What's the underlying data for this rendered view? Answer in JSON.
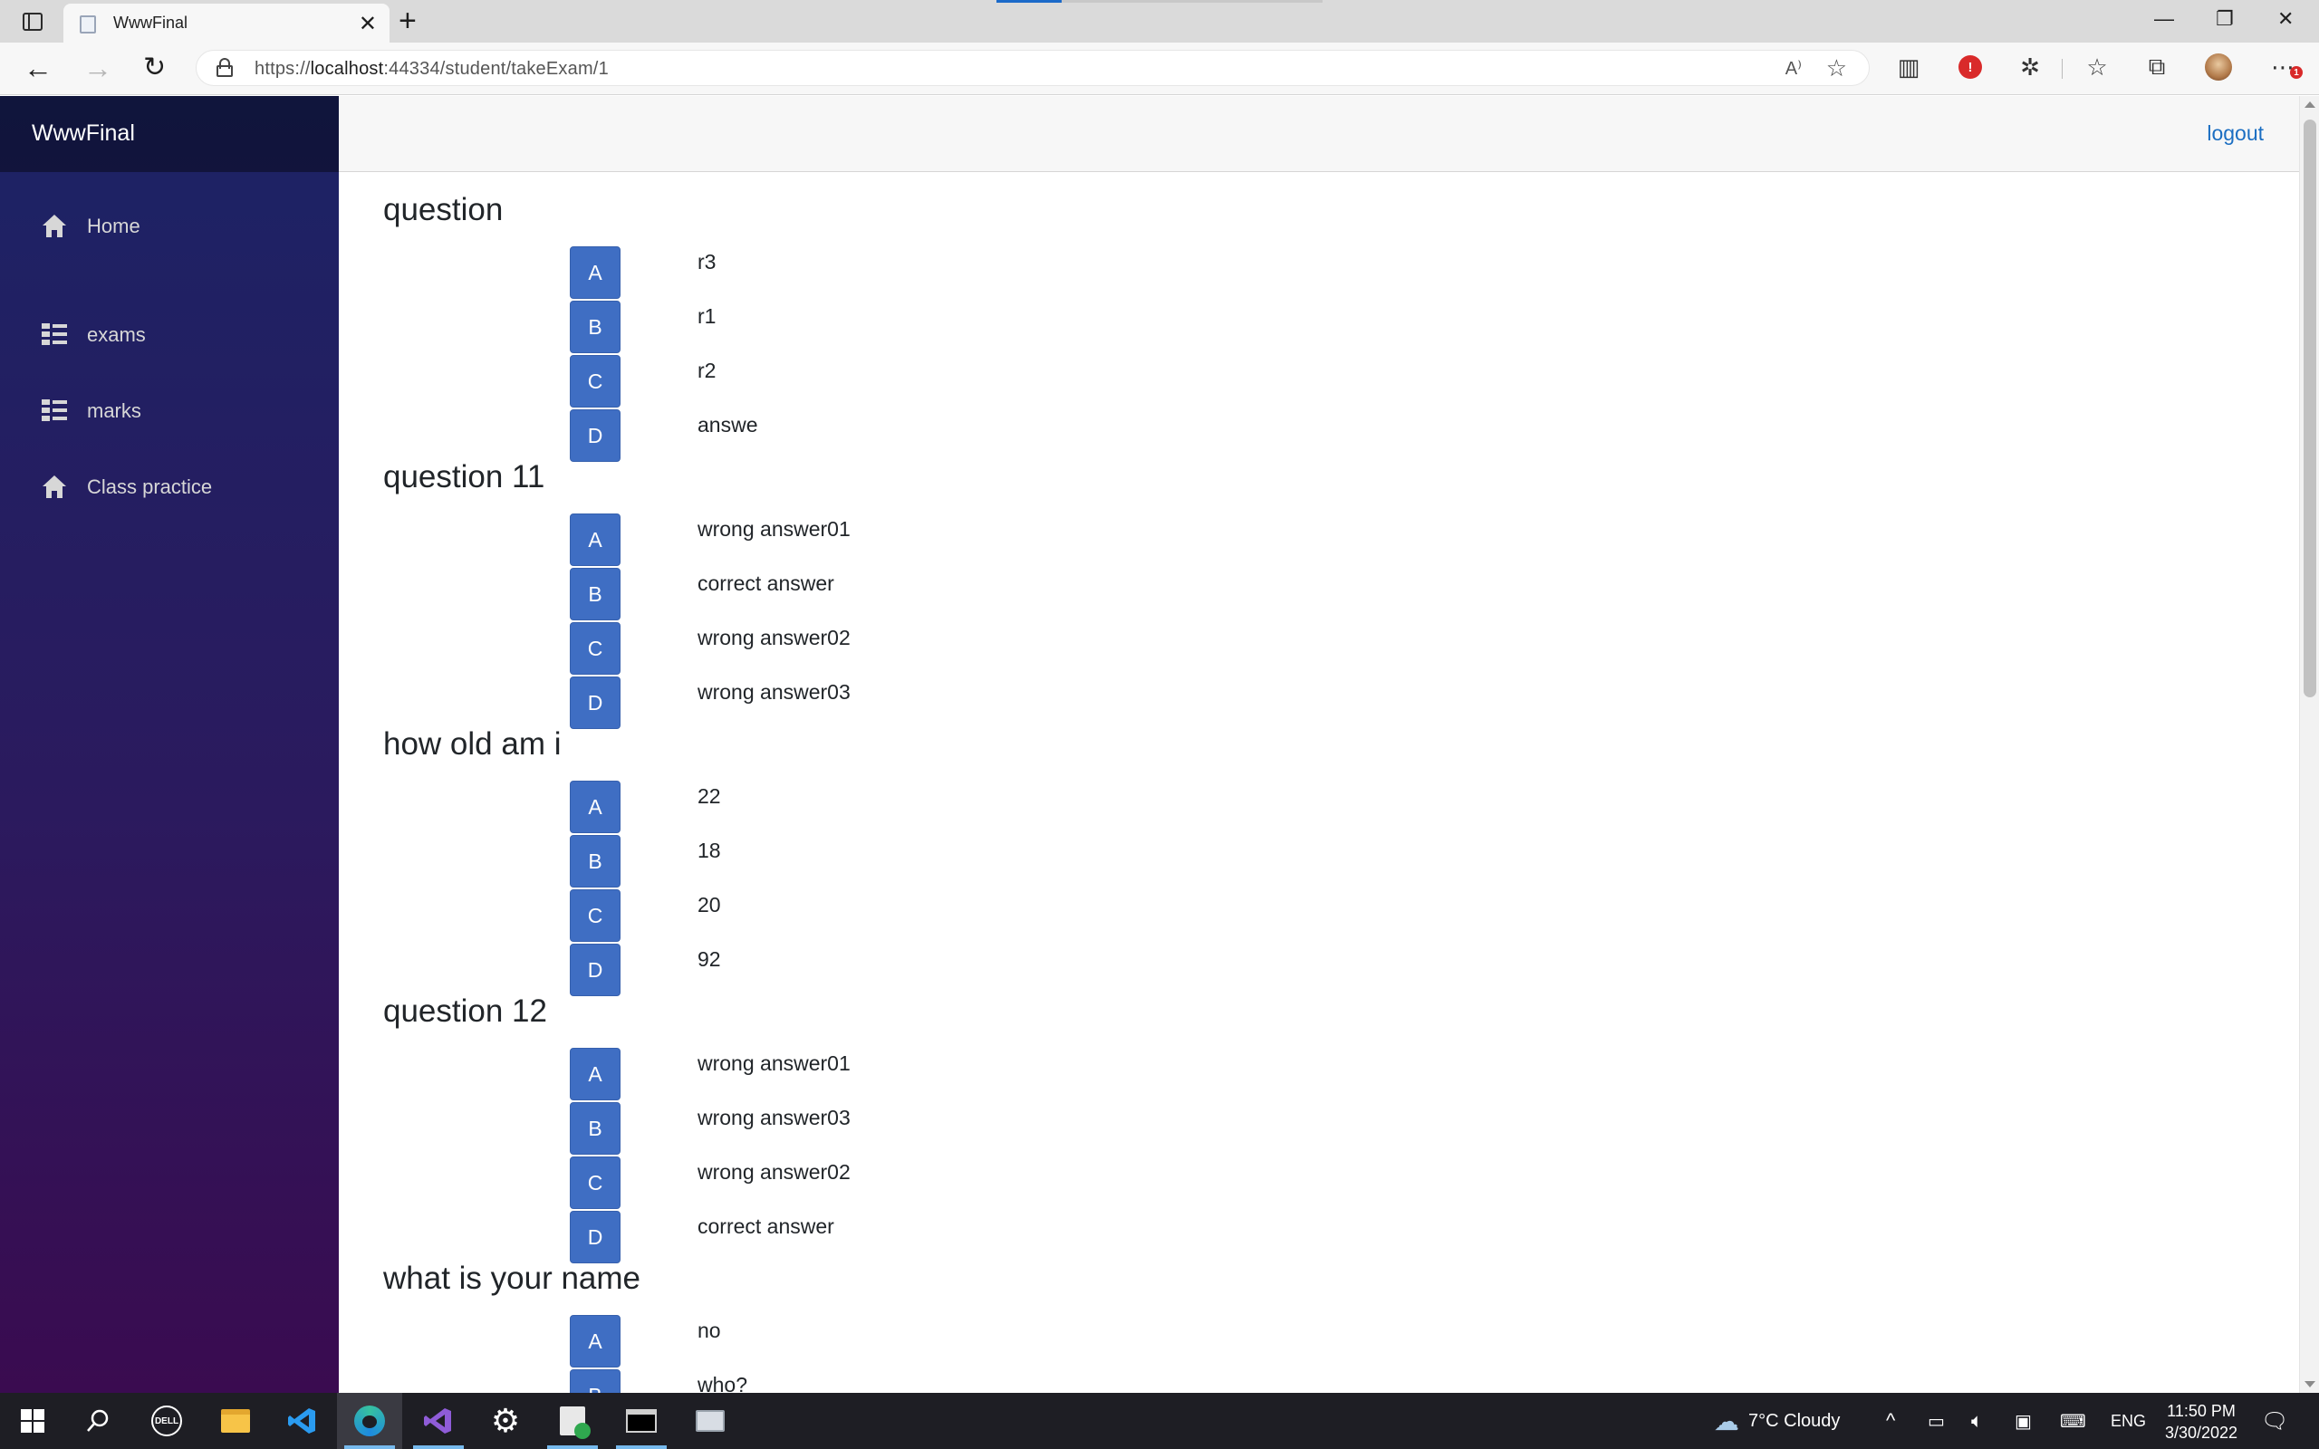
{
  "browser": {
    "tab_title": "WwwFinal",
    "url_prefix": "https://",
    "url_host": "localhost",
    "url_rest": ":44334/student/takeExam/1",
    "read_aloud": "A⁾",
    "dots_badge": "1"
  },
  "app": {
    "brand": "WwwFinal",
    "logout": "logout",
    "nav": [
      {
        "label": "Home",
        "icon": "home-icon"
      },
      {
        "label": "exams",
        "icon": "list-icon"
      },
      {
        "label": "marks",
        "icon": "list-icon"
      },
      {
        "label": "Class practice",
        "icon": "home-icon"
      }
    ]
  },
  "questions": [
    {
      "title": "question",
      "options": [
        {
          "letter": "A",
          "text": "r3"
        },
        {
          "letter": "B",
          "text": "r1"
        },
        {
          "letter": "C",
          "text": "r2"
        },
        {
          "letter": "D",
          "text": "answe"
        }
      ]
    },
    {
      "title": "question 11",
      "options": [
        {
          "letter": "A",
          "text": "wrong answer01"
        },
        {
          "letter": "B",
          "text": "correct answer"
        },
        {
          "letter": "C",
          "text": "wrong answer02"
        },
        {
          "letter": "D",
          "text": "wrong answer03"
        }
      ]
    },
    {
      "title": "how old am i",
      "options": [
        {
          "letter": "A",
          "text": "22"
        },
        {
          "letter": "B",
          "text": "18"
        },
        {
          "letter": "C",
          "text": "20"
        },
        {
          "letter": "D",
          "text": "92"
        }
      ]
    },
    {
      "title": "question 12",
      "options": [
        {
          "letter": "A",
          "text": "wrong answer01"
        },
        {
          "letter": "B",
          "text": "wrong answer03"
        },
        {
          "letter": "C",
          "text": "wrong answer02"
        },
        {
          "letter": "D",
          "text": "correct answer"
        }
      ]
    },
    {
      "title": "what is your name",
      "options": [
        {
          "letter": "A",
          "text": "no"
        },
        {
          "letter": "B",
          "text": "who?"
        }
      ]
    }
  ],
  "taskbar": {
    "weather": "7°C  Cloudy",
    "language": "ENG",
    "time": "11:50 PM",
    "date": "3/30/2022"
  },
  "colors": {
    "option_button": "#3f6ec3",
    "sidebar_top": "#1c2365",
    "sidebar_bottom": "#3a0b50",
    "link": "#1b6ec2"
  }
}
